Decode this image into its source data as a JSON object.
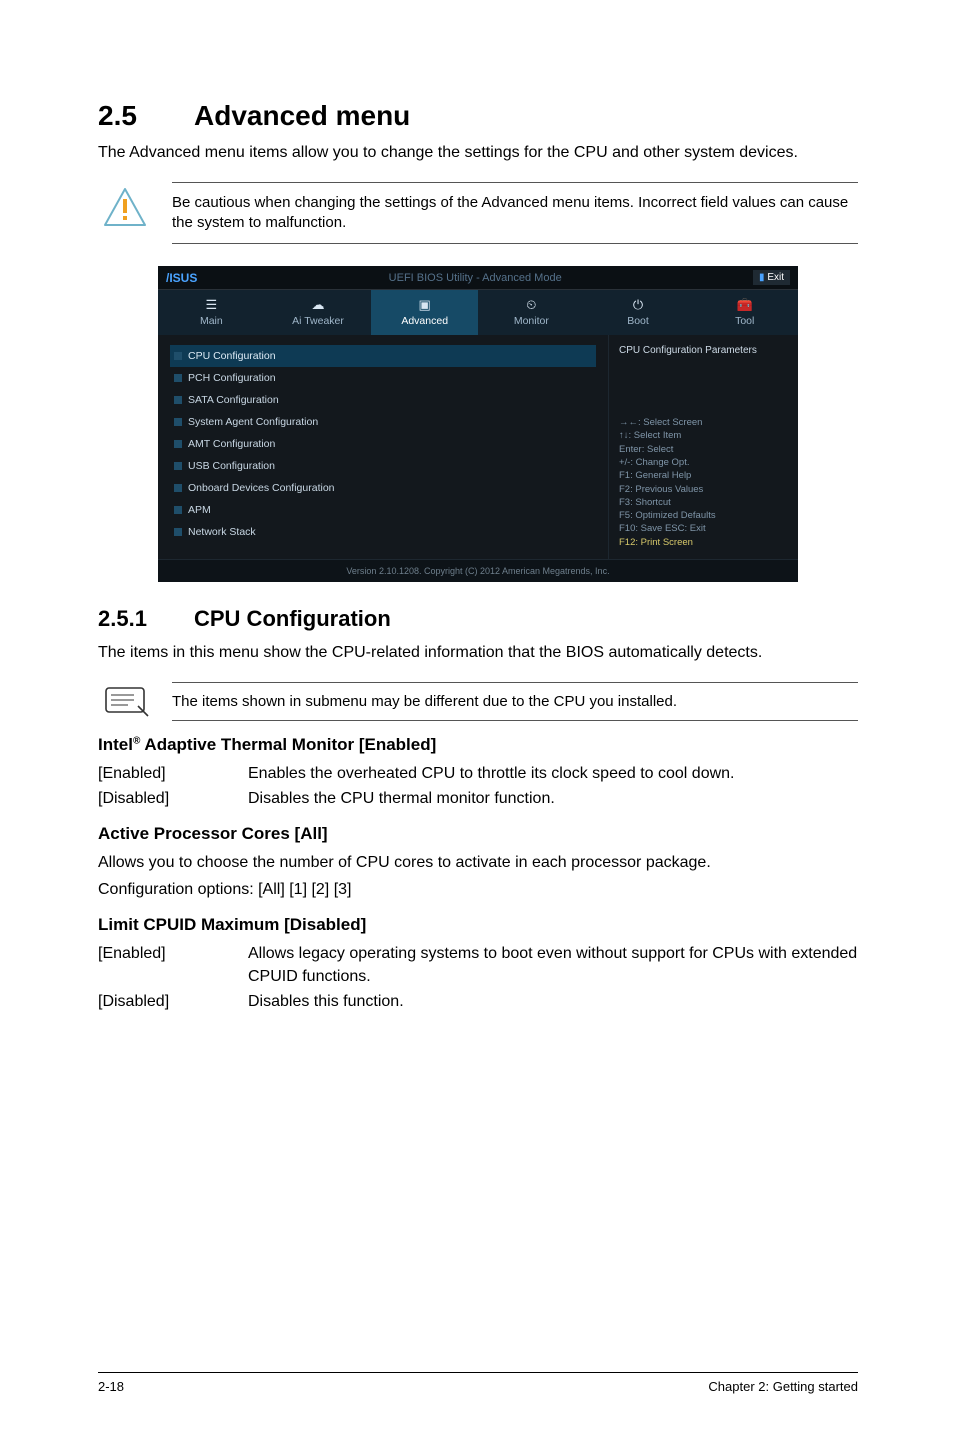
{
  "section": {
    "number": "2.5",
    "title": "Advanced menu",
    "intro": "The Advanced menu items allow you to change the settings for the CPU and other system devices."
  },
  "caution": "Be cautious when changing the settings of the Advanced menu items. Incorrect field values can cause the system to malfunction.",
  "bios": {
    "title": "UEFI BIOS Utility - Advanced Mode",
    "exit": "Exit",
    "tabs": [
      {
        "label": "Main"
      },
      {
        "label": "Ai Tweaker"
      },
      {
        "label": "Advanced"
      },
      {
        "label": "Monitor"
      },
      {
        "label": "Boot"
      },
      {
        "label": "Tool"
      }
    ],
    "items": [
      "CPU Configuration",
      "PCH Configuration",
      "SATA Configuration",
      "System Agent Configuration",
      "AMT Configuration",
      "USB Configuration",
      "Onboard Devices Configuration",
      "APM",
      "Network Stack"
    ],
    "right_title": "CPU Configuration Parameters",
    "hints": [
      "→←: Select Screen",
      "↑↓: Select Item",
      "Enter: Select",
      "+/-: Change Opt.",
      "F1: General Help",
      "F2: Previous Values",
      "F3: Shortcut",
      "F5: Optimized Defaults",
      "F10: Save  ESC: Exit",
      "F12: Print Screen"
    ],
    "footer": "Version 2.10.1208. Copyright (C) 2012 American Megatrends, Inc."
  },
  "subsection": {
    "number": "2.5.1",
    "title": "CPU Configuration",
    "intro": "The items in this menu show the CPU-related information that the BIOS automatically detects."
  },
  "note": "The items shown in submenu may be different due to the CPU you installed.",
  "options": {
    "thermal": {
      "title_pre": "Intel",
      "title_post": " Adaptive Thermal Monitor [Enabled]",
      "enabled": {
        "key": "[Enabled]",
        "val": "Enables the overheated CPU to throttle its clock speed to cool down."
      },
      "disabled": {
        "key": "[Disabled]",
        "val": "Disables the CPU thermal monitor function."
      }
    },
    "cores": {
      "title": "Active Processor Cores [All]",
      "p1": "Allows you to choose the number of CPU cores to activate in each processor package.",
      "p2": "Configuration options: [All] [1] [2] [3]"
    },
    "cpuid": {
      "title": "Limit CPUID Maximum [Disabled]",
      "enabled": {
        "key": "[Enabled]",
        "val": "Allows legacy operating systems to boot even without support for CPUs with extended CPUID functions."
      },
      "disabled": {
        "key": "[Disabled]",
        "val": "Disables this function."
      }
    }
  },
  "footer": {
    "left": "2-18",
    "right": "Chapter 2: Getting started"
  }
}
